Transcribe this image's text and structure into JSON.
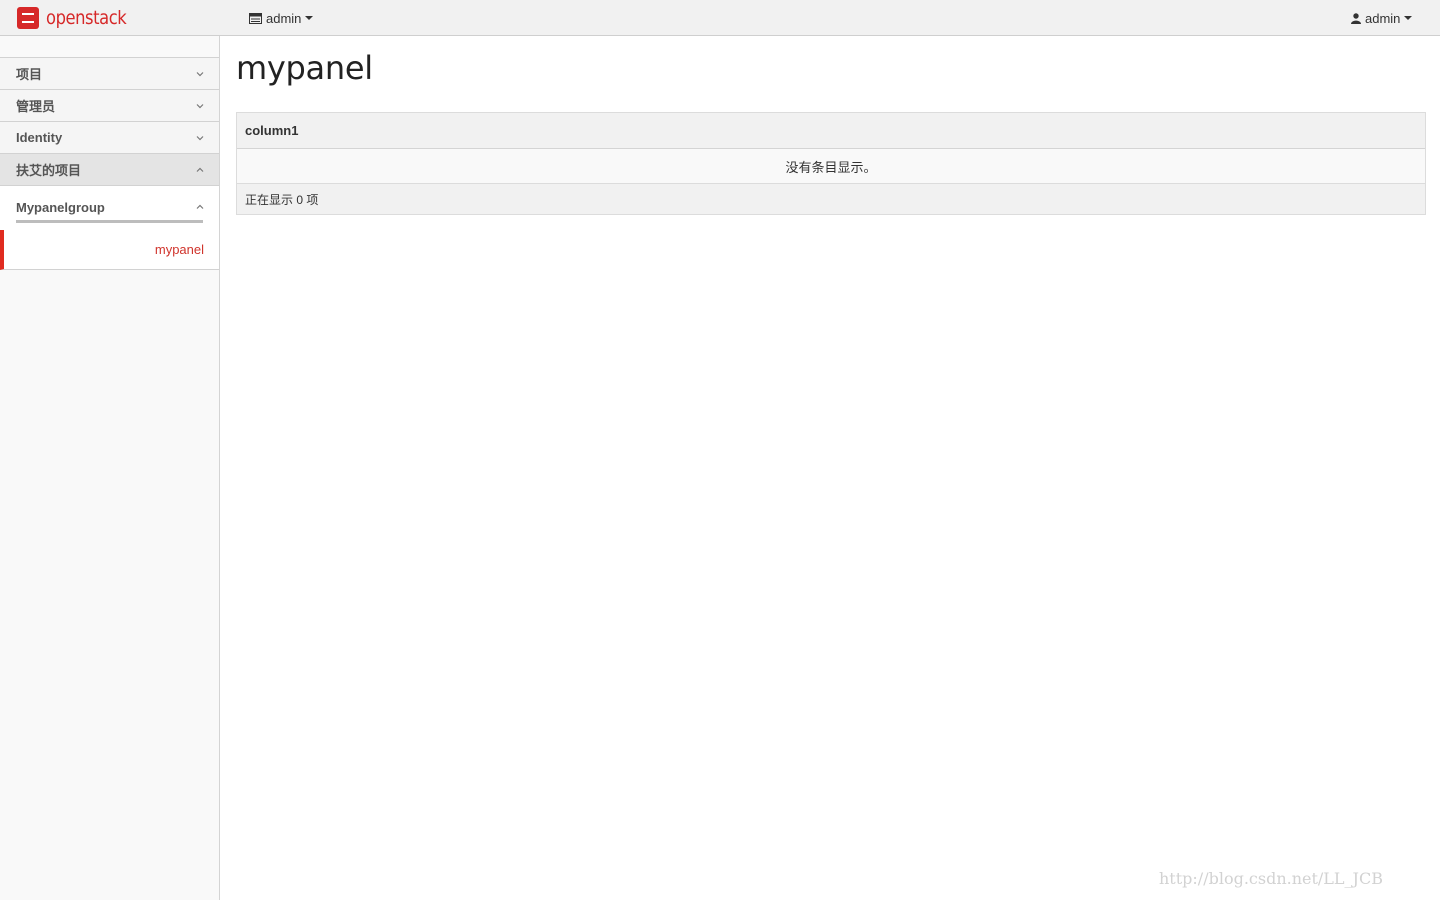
{
  "brand": {
    "name": "openstack",
    "color": "#d62828"
  },
  "navbar": {
    "project_selector": {
      "label": "admin",
      "icon": "server-icon"
    },
    "user_menu": {
      "label": "admin",
      "icon": "user-icon"
    }
  },
  "sidebar": {
    "sections": [
      {
        "label": "项目",
        "expanded": false
      },
      {
        "label": "管理员",
        "expanded": false
      },
      {
        "label": "Identity",
        "expanded": false
      },
      {
        "label": "扶艾的项目",
        "expanded": true
      }
    ],
    "group": {
      "label": "Mypanelgroup",
      "expanded": true
    },
    "active_item": {
      "label": "mypanel"
    }
  },
  "main": {
    "title": "mypanel",
    "table": {
      "columns": [
        "column1"
      ],
      "empty_message": "没有条目显示。",
      "footer": "正在显示 0 项"
    }
  },
  "watermark": "http://blog.csdn.net/LL_JCB",
  "colors": {
    "accent": "#e02b20",
    "navbar_bg": "#f1f1f1",
    "sidebar_bg": "#f9f9f9"
  }
}
